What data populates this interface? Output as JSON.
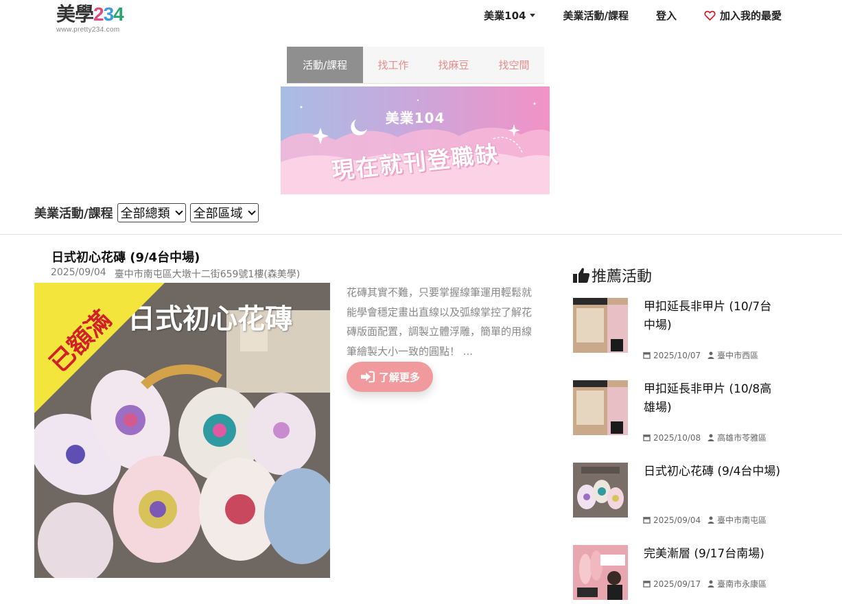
{
  "header": {
    "logo_mark_1": "美學",
    "logo_mark_2": "2",
    "logo_mark_3": "3",
    "logo_mark_4": "4",
    "logo_url": "www.pretty234.com",
    "nav": {
      "jobs": "美業104",
      "events": "美業活動/課程",
      "login": "登入",
      "favorite": "加入我的最愛"
    }
  },
  "tabs": [
    {
      "label": "活動/課程",
      "active": true
    },
    {
      "label": "找工作",
      "active": false
    },
    {
      "label": "找麻豆",
      "active": false
    },
    {
      "label": "找空間",
      "active": false
    }
  ],
  "banner": {
    "subtitle": "美業104",
    "title": "現在就刊登職缺"
  },
  "filter": {
    "label": "美業活動/課程",
    "category_selected": "全部總類",
    "region_selected": "全部區域"
  },
  "article": {
    "title": "日式初心花磚 (9/4台中場)",
    "date": "2025/09/04",
    "location": "臺中市南屯區大墩十二街659號1樓(森美學)",
    "image_title": "日式初心花磚",
    "ribbon": "已額滿",
    "description": "花磚其實不難，只要掌握線筆運用輕鬆就能學會穩定畫出直線以及弧線掌控了解花磚版面配置，調製立體浮雕，簡單的用線筆繪製大小一致的圓點！ ...",
    "more_label": "了解更多"
  },
  "sidebar": {
    "heading": "推薦活動",
    "items": [
      {
        "title": "甲扣延長非甲片 (10/7台中場)",
        "date": "2025/10/07",
        "location": "臺中市西區",
        "thumb_color": "#c9a98a"
      },
      {
        "title": "甲扣延長非甲片 (10/8高雄場)",
        "date": "2025/10/08",
        "location": "高雄市苓雅區",
        "thumb_color": "#c9a98a"
      },
      {
        "title": "日式初心花磚 (9/4台中場)",
        "date": "2025/09/04",
        "location": "臺中市南屯區",
        "thumb_color": "#7a6f68"
      },
      {
        "title": "完美漸層 (9/17台南場)",
        "date": "2025/09/17",
        "location": "臺南市永康區",
        "thumb_color": "#e8a6b0"
      }
    ]
  },
  "colors": {
    "accent_pink": "#ec8a8a",
    "button_pink": "#f19a9d",
    "tab_active": "#8f8f8f",
    "ribbon_yellow": "#f3e53c",
    "ribbon_text": "#d2202a"
  }
}
